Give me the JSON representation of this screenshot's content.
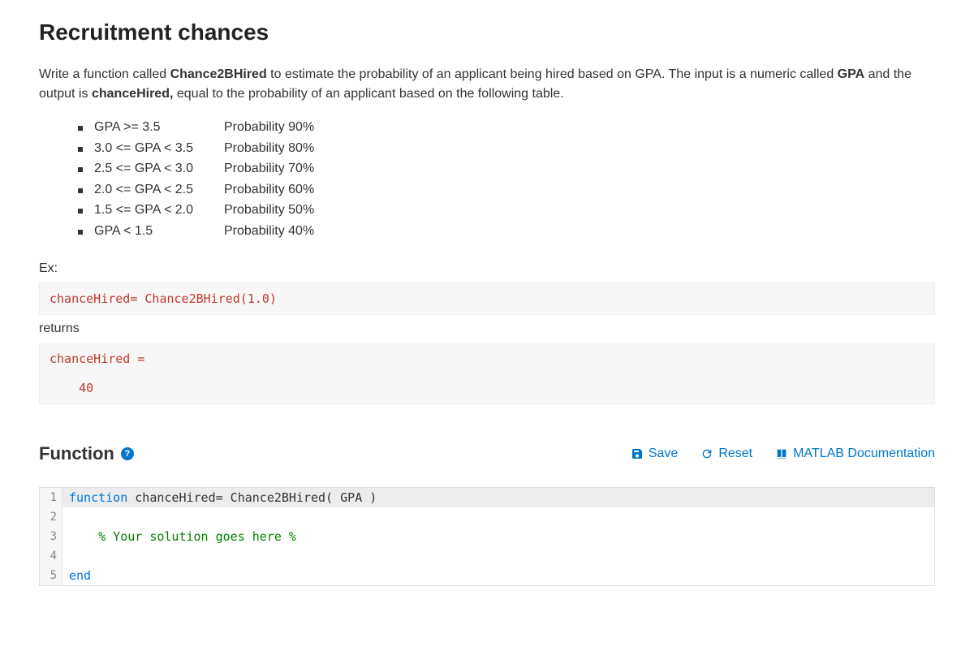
{
  "title": "Recruitment chances",
  "intro": {
    "part1": "Write a function called ",
    "fn": "Chance2BHired",
    "part2": " to estimate the probability of an applicant being hired based on GPA.  The input is a numeric called ",
    "input": "GPA",
    "part3": " and the output is ",
    "output": "chanceHired,",
    "part4": " equal to the probability of an applicant based on the following table."
  },
  "rows": [
    {
      "range": "GPA >= 3.5",
      "prob": "Probability  90%"
    },
    {
      "range": "3.0 <= GPA < 3.5",
      "prob": "Probability  80%"
    },
    {
      "range": "2.5 <= GPA < 3.0",
      "prob": "Probability  70%"
    },
    {
      "range": "2.0 <= GPA < 2.5",
      "prob": "Probability  60%"
    },
    {
      "range": "1.5 <= GPA < 2.0",
      "prob": "Probability  50%"
    },
    {
      "range": "GPA < 1.5",
      "prob": "Probability  40%"
    }
  ],
  "ex_label": "Ex:",
  "ex_call": "chanceHired= Chance2BHired(1.0)",
  "returns_label": "returns",
  "ex_result": "chanceHired =\n\n    40",
  "section": {
    "title": "Function",
    "help": "?",
    "save": "Save",
    "reset": "Reset",
    "docs": "MATLAB Documentation"
  },
  "editor": {
    "lines": [
      {
        "n": "1",
        "kw": "function",
        "rest": " chanceHired= Chance2BHired( GPA )"
      },
      {
        "n": "2",
        "rest": ""
      },
      {
        "n": "3",
        "comment": "    % Your solution goes here %"
      },
      {
        "n": "4",
        "rest": ""
      },
      {
        "n": "5",
        "kw": "end",
        "rest": ""
      }
    ]
  }
}
